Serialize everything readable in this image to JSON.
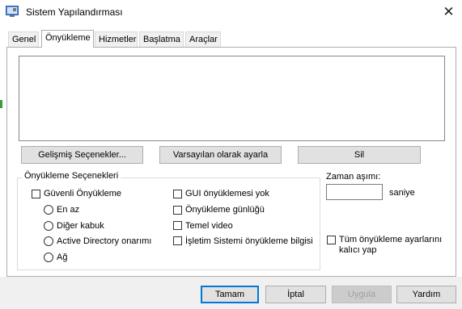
{
  "window": {
    "title": "Sistem Yapılandırması",
    "close_glyph": "✕"
  },
  "tabs": [
    {
      "label": "Genel",
      "active": false
    },
    {
      "label": "Önyükleme",
      "active": true
    },
    {
      "label": "Hizmetler",
      "active": false
    },
    {
      "label": "Başlatma",
      "active": false
    },
    {
      "label": "Araçlar",
      "active": false
    }
  ],
  "boot": {
    "advanced_button": "Gelişmiş Seçenekler...",
    "set_default_button": "Varsayılan olarak ayarla",
    "delete_button": "Sil",
    "options_group_label": "Önyükleme Seçenekleri",
    "safe_boot": "Güvenli Önyükleme",
    "minimal": "En az",
    "alternate_shell": "Diğer kabuk",
    "active_directory_repair": "Active Directory onarımı",
    "network": "Ağ",
    "no_gui_boot": "GUI önyüklemesi yok",
    "boot_log": "Önyükleme günlüğü",
    "base_video": "Temel video",
    "os_boot_info": "İşletim Sistemi önyükleme bilgisi",
    "timeout_label": "Zaman aşımı:",
    "timeout_value": "",
    "seconds_label": "saniye",
    "make_permanent_line1": "Tüm önyükleme ayarlarını",
    "make_permanent_line2": "kalıcı yap"
  },
  "footer": {
    "ok": "Tamam",
    "cancel": "İptal",
    "apply": "Uygula",
    "help": "Yardım"
  },
  "colors": {
    "accent": "#0078d7",
    "footer_bg": "#f0f0f0"
  }
}
